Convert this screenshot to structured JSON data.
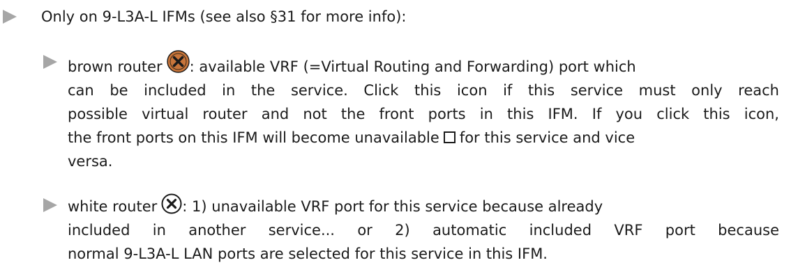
{
  "heading": {
    "text": "Only on 9-L3A-L IFMs (see also §31 for more info):"
  },
  "items": [
    {
      "icon": "brown-router-icon",
      "lines": [
        [
          "brown router",
          ": available VRF (=Virtual Routing and Forwarding) port which"
        ],
        [
          "can be included in the service. Click this icon if this service must only reach"
        ],
        [
          "possible virtual router and not the front ports in this IFM. If you click this icon,"
        ],
        [
          "the front ports on this IFM will become unavailable",
          "for this service and vice"
        ],
        [
          "versa."
        ]
      ],
      "colors": {
        "icon_fill": "#c8753a",
        "icon_x": "#1a1a1a"
      }
    },
    {
      "icon": "white-router-icon",
      "lines": [
        [
          "white router",
          ": 1) unavailable VRF port for this service because already"
        ],
        [
          "included in another service... or 2) automatic included VRF port because"
        ],
        [
          "normal 9-L3A-L LAN ports are selected for this service in this IFM."
        ]
      ],
      "colors": {
        "icon_fill": "#ffffff",
        "icon_x": "#1a1a1a"
      }
    }
  ],
  "colors": {
    "bullet": "#a6a6a6",
    "text": "#1a1a1a",
    "background": "#ffffff"
  }
}
